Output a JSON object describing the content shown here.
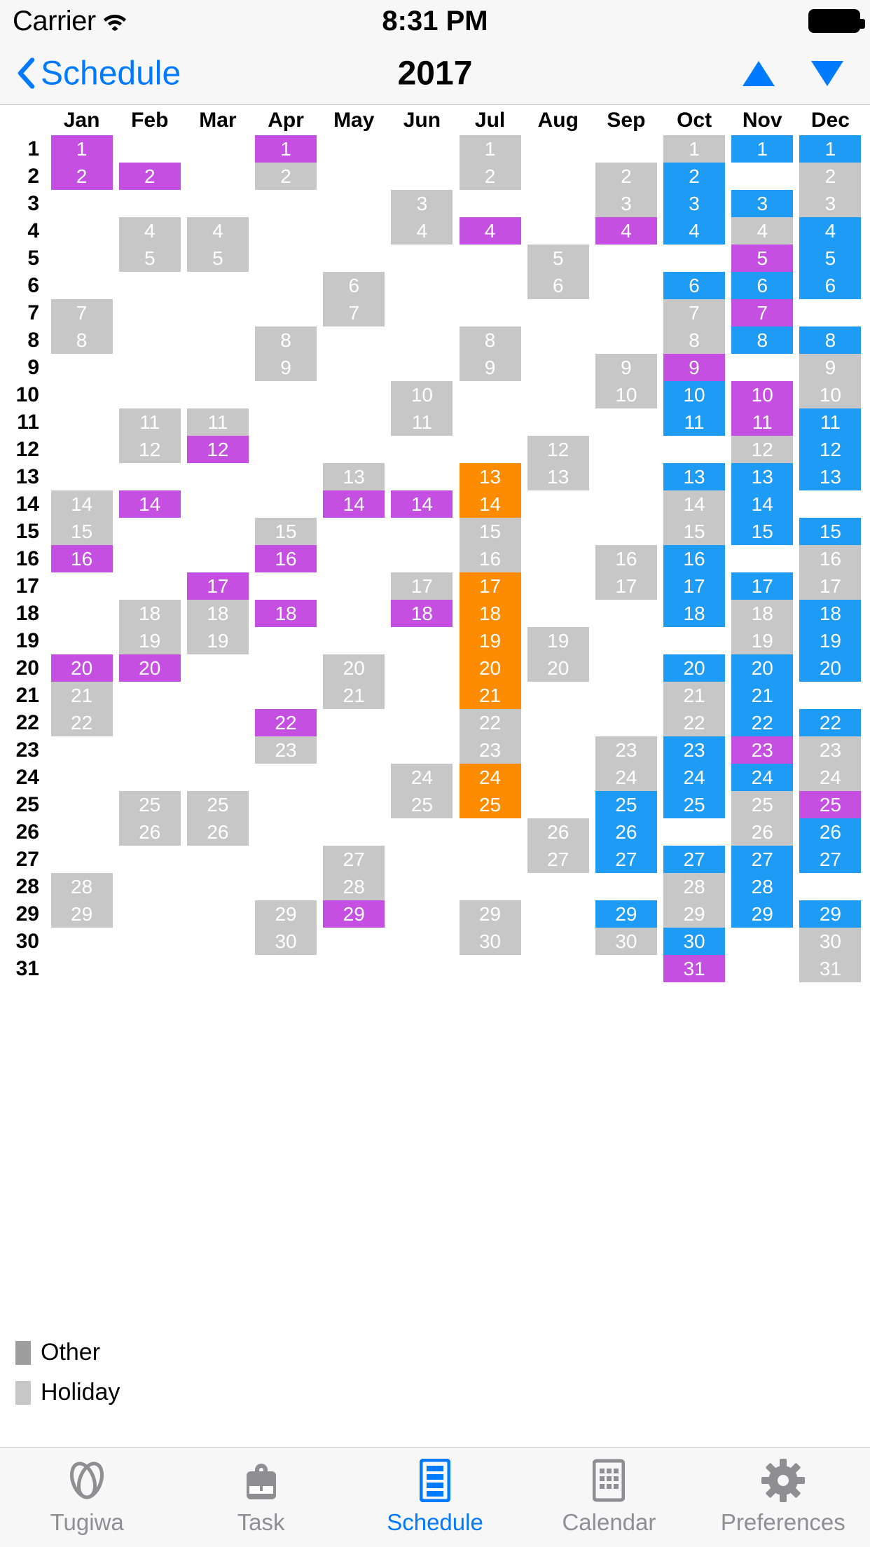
{
  "status_bar": {
    "carrier": "Carrier",
    "wifi_icon": "wifi-icon",
    "time": "8:31 PM",
    "battery_icon": "battery-full-icon"
  },
  "nav_bar": {
    "back_icon": "chevron-left-icon",
    "back_label": "Schedule",
    "title": "2017",
    "up_icon": "triangle-up-icon",
    "down_icon": "triangle-down-icon"
  },
  "colors": {
    "other": "#c7c7c7",
    "holiday": "#c7c7c7",
    "magenta": "#c44fe0",
    "blue": "#1e9bf5",
    "orange": "#ff8c00",
    "accent": "#007aff",
    "inactive": "#8e8e93"
  },
  "calendar": {
    "months": [
      "Jan",
      "Feb",
      "Mar",
      "Apr",
      "May",
      "Jun",
      "Jul",
      "Aug",
      "Sep",
      "Oct",
      "Nov",
      "Dec"
    ],
    "day_numbers": [
      1,
      2,
      3,
      4,
      5,
      6,
      7,
      8,
      9,
      10,
      11,
      12,
      13,
      14,
      15,
      16,
      17,
      18,
      19,
      20,
      21,
      22,
      23,
      24,
      25,
      26,
      27,
      28,
      29,
      30,
      31
    ],
    "rows": [
      {
        "day": "1",
        "cells": [
          "magenta",
          "",
          "",
          "magenta",
          "",
          "",
          "other",
          "",
          "",
          "other",
          "blue",
          "blue"
        ]
      },
      {
        "day": "2",
        "cells": [
          "magenta",
          "magenta",
          "",
          "other",
          "",
          "",
          "other",
          "",
          "other",
          "blue",
          "",
          "other"
        ]
      },
      {
        "day": "3",
        "cells": [
          "",
          "",
          "",
          "",
          "",
          "other",
          "",
          "",
          "other",
          "blue",
          "blue",
          "other"
        ]
      },
      {
        "day": "4",
        "cells": [
          "",
          "other",
          "other",
          "",
          "",
          "other",
          "magenta",
          "",
          "magenta",
          "blue",
          "other",
          "blue"
        ]
      },
      {
        "day": "5",
        "cells": [
          "",
          "other",
          "other",
          "",
          "",
          "",
          "",
          "other",
          "",
          "",
          "magenta",
          "blue"
        ]
      },
      {
        "day": "6",
        "cells": [
          "",
          "",
          "",
          "",
          "other",
          "",
          "",
          "other",
          "",
          "blue",
          "blue",
          "blue"
        ]
      },
      {
        "day": "7",
        "cells": [
          "other",
          "",
          "",
          "",
          "other",
          "",
          "",
          "",
          "",
          "other",
          "magenta",
          ""
        ]
      },
      {
        "day": "8",
        "cells": [
          "other",
          "",
          "",
          "other",
          "",
          "",
          "other",
          "",
          "",
          "other",
          "blue",
          "blue"
        ]
      },
      {
        "day": "9",
        "cells": [
          "",
          "",
          "",
          "other",
          "",
          "",
          "other",
          "",
          "other",
          "magenta",
          "",
          "other"
        ]
      },
      {
        "day": "10",
        "cells": [
          "",
          "",
          "",
          "",
          "",
          "other",
          "",
          "",
          "other",
          "blue",
          "magenta",
          "other"
        ]
      },
      {
        "day": "11",
        "cells": [
          "",
          "other",
          "other",
          "",
          "",
          "other",
          "",
          "",
          "",
          "blue",
          "magenta",
          "blue"
        ]
      },
      {
        "day": "12",
        "cells": [
          "",
          "other",
          "magenta",
          "",
          "",
          "",
          "",
          "other",
          "",
          "",
          "other",
          "blue"
        ]
      },
      {
        "day": "13",
        "cells": [
          "",
          "",
          "",
          "",
          "other",
          "",
          "orange",
          "other",
          "",
          "blue",
          "blue",
          "blue"
        ]
      },
      {
        "day": "14",
        "cells": [
          "other",
          "magenta",
          "",
          "",
          "magenta",
          "magenta",
          "orange",
          "",
          "",
          "other",
          "blue",
          ""
        ]
      },
      {
        "day": "15",
        "cells": [
          "other",
          "",
          "",
          "other",
          "",
          "",
          "other",
          "",
          "",
          "other",
          "blue",
          "blue"
        ]
      },
      {
        "day": "16",
        "cells": [
          "magenta",
          "",
          "",
          "magenta",
          "",
          "",
          "other",
          "",
          "other",
          "blue",
          "",
          "other"
        ]
      },
      {
        "day": "17",
        "cells": [
          "",
          "",
          "magenta",
          "",
          "",
          "other",
          "orange",
          "",
          "other",
          "blue",
          "blue",
          "other"
        ]
      },
      {
        "day": "18",
        "cells": [
          "",
          "other",
          "other",
          "magenta",
          "",
          "magenta",
          "orange",
          "",
          "",
          "blue",
          "other",
          "blue"
        ]
      },
      {
        "day": "19",
        "cells": [
          "",
          "other",
          "other",
          "",
          "",
          "",
          "orange",
          "other",
          "",
          "",
          "other",
          "blue"
        ]
      },
      {
        "day": "20",
        "cells": [
          "magenta",
          "magenta",
          "",
          "",
          "other",
          "",
          "orange",
          "other",
          "",
          "blue",
          "blue",
          "blue"
        ]
      },
      {
        "day": "21",
        "cells": [
          "other",
          "",
          "",
          "",
          "other",
          "",
          "orange",
          "",
          "",
          "other",
          "blue",
          ""
        ]
      },
      {
        "day": "22",
        "cells": [
          "other",
          "",
          "",
          "magenta",
          "",
          "",
          "other",
          "",
          "",
          "other",
          "blue",
          "blue"
        ]
      },
      {
        "day": "23",
        "cells": [
          "",
          "",
          "",
          "other",
          "",
          "",
          "other",
          "",
          "other",
          "blue",
          "magenta",
          "other"
        ]
      },
      {
        "day": "24",
        "cells": [
          "",
          "",
          "",
          "",
          "",
          "other",
          "orange",
          "",
          "other",
          "blue",
          "blue",
          "other"
        ]
      },
      {
        "day": "25",
        "cells": [
          "",
          "other",
          "other",
          "",
          "",
          "other",
          "orange",
          "",
          "blue",
          "blue",
          "other",
          "magenta"
        ]
      },
      {
        "day": "26",
        "cells": [
          "",
          "other",
          "other",
          "",
          "",
          "",
          "",
          "other",
          "blue",
          "",
          "other",
          "blue"
        ]
      },
      {
        "day": "27",
        "cells": [
          "",
          "",
          "",
          "",
          "other",
          "",
          "",
          "other",
          "blue",
          "blue",
          "blue",
          "blue"
        ]
      },
      {
        "day": "28",
        "cells": [
          "other",
          "",
          "",
          "",
          "other",
          "",
          "",
          "",
          "",
          "other",
          "blue",
          ""
        ]
      },
      {
        "day": "29",
        "cells": [
          "other",
          "",
          "",
          "other",
          "magenta",
          "",
          "other",
          "",
          "blue",
          "other",
          "blue",
          "blue"
        ]
      },
      {
        "day": "30",
        "cells": [
          "",
          "",
          "",
          "other",
          "",
          "",
          "other",
          "",
          "other",
          "blue",
          "",
          "other"
        ]
      },
      {
        "day": "31",
        "cells": [
          "",
          "",
          "",
          "",
          "",
          "",
          "",
          "",
          "",
          "magenta",
          "",
          "other"
        ]
      }
    ]
  },
  "legend": [
    {
      "label": "Other",
      "swatch": "#9e9e9e"
    },
    {
      "label": "Holiday",
      "swatch": "#c7c7c7"
    }
  ],
  "tab_bar": {
    "items": [
      {
        "label": "Tugiwa",
        "icon": "rings-icon",
        "active": false
      },
      {
        "label": "Task",
        "icon": "bag-icon",
        "active": false
      },
      {
        "label": "Schedule",
        "icon": "list-icon",
        "active": true
      },
      {
        "label": "Calendar",
        "icon": "calendar-icon",
        "active": false
      },
      {
        "label": "Preferences",
        "icon": "gear-icon",
        "active": false
      }
    ]
  }
}
